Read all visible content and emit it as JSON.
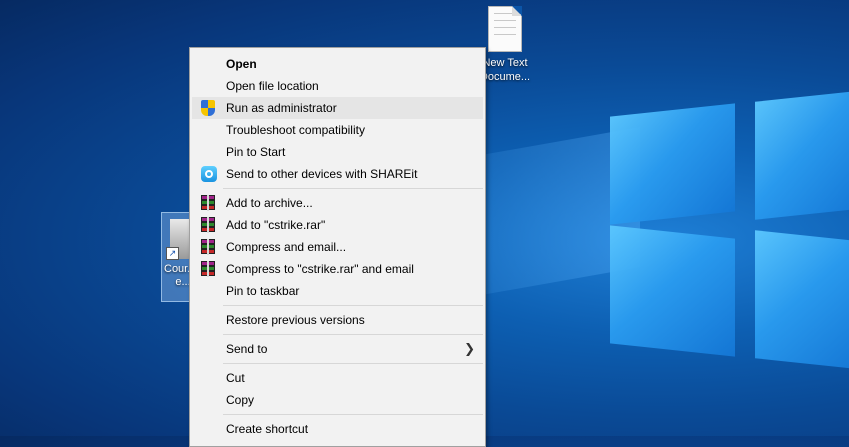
{
  "desktop": {
    "file_icon_label_line1": "New Text",
    "file_icon_label_line2": "Docume...",
    "selected_icon_label_line1": "Cour...",
    "selected_icon_label_line2": "e..."
  },
  "context_menu": {
    "items": [
      {
        "label": "Open",
        "bold": true,
        "icon": null
      },
      {
        "label": "Open file location",
        "icon": null
      },
      {
        "label": "Run as administrator",
        "icon": "uac-shield-icon",
        "hovered": true
      },
      {
        "label": "Troubleshoot compatibility",
        "icon": null
      },
      {
        "label": "Pin to Start",
        "icon": null
      },
      {
        "label": "Send to other devices with SHAREit",
        "icon": "shareit-icon"
      },
      {
        "label": "Add to archive...",
        "icon": "winrar-icon"
      },
      {
        "label": "Add to \"cstrike.rar\"",
        "icon": "winrar-icon"
      },
      {
        "label": "Compress and email...",
        "icon": "winrar-icon"
      },
      {
        "label": "Compress to \"cstrike.rar\" and email",
        "icon": "winrar-icon"
      },
      {
        "label": "Pin to taskbar",
        "icon": null
      },
      {
        "label": "Restore previous versions",
        "icon": null
      },
      {
        "label": "Send to",
        "icon": null,
        "submenu": true
      },
      {
        "label": "Cut",
        "icon": null
      },
      {
        "label": "Copy",
        "icon": null
      },
      {
        "label": "Create shortcut",
        "icon": null
      }
    ]
  },
  "colors": {
    "desktop_blue": "#0a4a96",
    "logo_blue": "#2a9cf0",
    "menu_bg": "#f2f2f2",
    "menu_hover": "#e5e5e5"
  }
}
